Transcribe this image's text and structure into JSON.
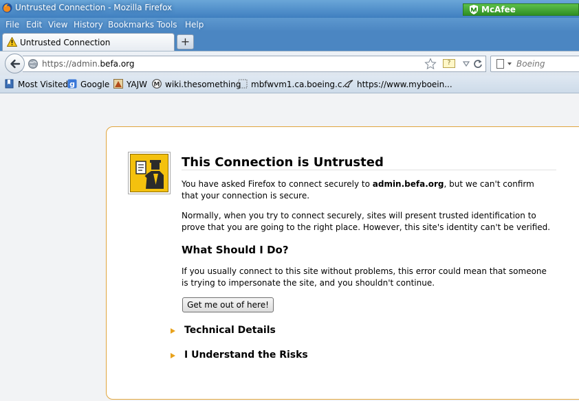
{
  "window": {
    "title": "Untrusted Connection - Mozilla Firefox"
  },
  "mcafee": {
    "label": "McAfee",
    "color": "#3aa02e"
  },
  "menu": {
    "items": [
      "File",
      "Edit",
      "View",
      "History",
      "Bookmarks",
      "Tools",
      "Help"
    ]
  },
  "tab": {
    "label": "Untrusted Connection",
    "new_tab_label": "+"
  },
  "nav": {
    "url_prefix": "https://admin.",
    "url_domain": "befa.org",
    "identity_badge": "?",
    "search_placeholder": "Boeing"
  },
  "bookmarks": {
    "items": [
      {
        "label": "Most Visited",
        "icon": "bookmarks-folder-icon"
      },
      {
        "label": "Google",
        "icon": "google-icon"
      },
      {
        "label": "YAJW",
        "icon": "yajw-icon"
      },
      {
        "label": "wiki.thesomething",
        "icon": "wiki-icon"
      },
      {
        "label": "mbfwvm1.ca.boeing.c...",
        "icon": "page-icon"
      },
      {
        "label": "https://www.myboein...",
        "icon": "boeing-icon"
      }
    ]
  },
  "error": {
    "title": "This Connection is Untrusted",
    "p1_before": "You have asked Firefox to connect securely to ",
    "p1_host": "admin.befa.org",
    "p1_after": ", but we can't confirm that your connection is secure.",
    "p2": "Normally, when you try to connect securely, sites will present trusted identification to prove that you are going to the right place. However, this site's identity can't be verified.",
    "what_title": "What Should I Do?",
    "p3": "If you usually connect to this site without problems, this error could mean that someone is trying to impersonate the site, and you shouldn't continue.",
    "get_out_button": "Get me out of here!",
    "technical_details": "Technical Details",
    "understand_risks": "I Understand the Risks",
    "accent_color": "#e0a43c"
  }
}
